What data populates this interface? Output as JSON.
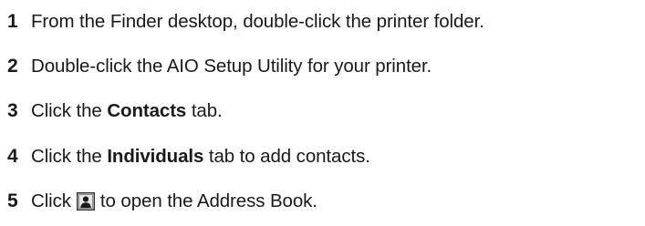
{
  "steps": [
    {
      "number": "1",
      "text": "From the Finder desktop, double-click the printer folder."
    },
    {
      "number": "2",
      "text": "Double-click the AIO Setup Utility for your printer."
    },
    {
      "number": "3",
      "before": "Click the ",
      "bold": "Contacts",
      "after": " tab."
    },
    {
      "number": "4",
      "before": "Click the ",
      "bold": "Individuals",
      "after": " tab to add contacts."
    },
    {
      "number": "5",
      "before": "Click",
      "icon": "contact-card-icon",
      "after": "to open the Address Book."
    }
  ]
}
